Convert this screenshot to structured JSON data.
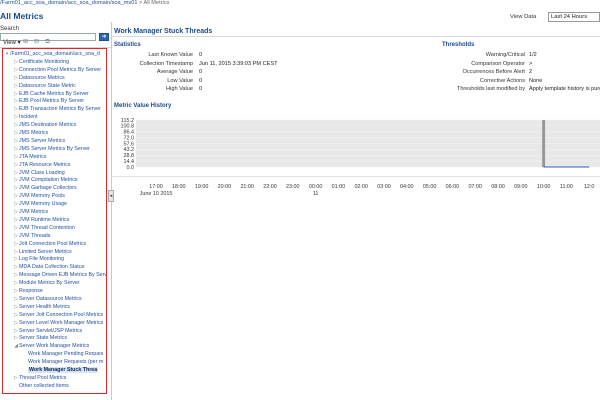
{
  "breadcrumb": {
    "path": "/Farm01_acc_soa_domain/acc_soa_domain/soa_ms01",
    "separator": ">",
    "current": "All Metrics"
  },
  "page_title": "All Metrics",
  "left_panel": {
    "search_label": "Search",
    "search_value": "",
    "view_label": "View ▾",
    "tree": [
      {
        "label": "/Farm01_acc_soa_domain/acc_soa_d",
        "level": 0,
        "toggle": "▾",
        "root": true
      },
      {
        "label": "Certificate Monitoring",
        "level": 1,
        "toggle": "▷"
      },
      {
        "label": "Connection Pool Metrics By Server",
        "level": 1,
        "toggle": "▷"
      },
      {
        "label": "Datasource Metrics",
        "level": 1,
        "toggle": "▷"
      },
      {
        "label": "Datasource State Metric",
        "level": 1,
        "toggle": "▷"
      },
      {
        "label": "EJB Cache Metrics By Server",
        "level": 1,
        "toggle": "▷"
      },
      {
        "label": "EJB Pool Metrics By Server",
        "level": 1,
        "toggle": "▷"
      },
      {
        "label": "EJB Transaction Metrics By Server",
        "level": 1,
        "toggle": "▷"
      },
      {
        "label": "Incident",
        "level": 1,
        "toggle": "▷"
      },
      {
        "label": "JMS Destination Metrics",
        "level": 1,
        "toggle": "▷"
      },
      {
        "label": "JMS Metrics",
        "level": 1,
        "toggle": "▷"
      },
      {
        "label": "JMS Server Metrics",
        "level": 1,
        "toggle": "▷"
      },
      {
        "label": "JMS Server Metrics By Server",
        "level": 1,
        "toggle": "▷"
      },
      {
        "label": "JTA Metrics",
        "level": 1,
        "toggle": "▷"
      },
      {
        "label": "JTA Resource Metrics",
        "level": 1,
        "toggle": "▷"
      },
      {
        "label": "JVM Class Loading",
        "level": 1,
        "toggle": "▷"
      },
      {
        "label": "JVM Compilation Metrics",
        "level": 1,
        "toggle": "▷"
      },
      {
        "label": "JVM Garbage Collectors",
        "level": 1,
        "toggle": "▷"
      },
      {
        "label": "JVM Memory Pools",
        "level": 1,
        "toggle": "▷"
      },
      {
        "label": "JVM Memory Usage",
        "level": 1,
        "toggle": "▷"
      },
      {
        "label": "JVM Metrics",
        "level": 1,
        "toggle": "▷"
      },
      {
        "label": "JVM Runtime Metrics",
        "level": 1,
        "toggle": "▷"
      },
      {
        "label": "JVM Thread Contention",
        "level": 1,
        "toggle": "▷"
      },
      {
        "label": "JVM Threads",
        "level": 1,
        "toggle": "▷"
      },
      {
        "label": "Jolt Connection Pool Metrics",
        "level": 1,
        "toggle": "▷"
      },
      {
        "label": "Limited Server Metrics",
        "level": 1,
        "toggle": "▷"
      },
      {
        "label": "Log File Monitoring",
        "level": 1,
        "toggle": "▷"
      },
      {
        "label": "MDA Data Collection Status",
        "level": 1,
        "toggle": "▷"
      },
      {
        "label": "Message Driven EJB Metrics By Serv",
        "level": 1,
        "toggle": "▷"
      },
      {
        "label": "Module Metrics By Server",
        "level": 1,
        "toggle": "▷"
      },
      {
        "label": "Response",
        "level": 1,
        "toggle": "▷"
      },
      {
        "label": "Server Datasource Metrics",
        "level": 1,
        "toggle": "▷"
      },
      {
        "label": "Server Health Metrics",
        "level": 1,
        "toggle": "▷"
      },
      {
        "label": "Server Jolt Connection Pool Metrics",
        "level": 1,
        "toggle": "▷"
      },
      {
        "label": "Server Level Work Manager Metrics",
        "level": 1,
        "toggle": "▷"
      },
      {
        "label": "Server Servlet/JSP Metrics",
        "level": 1,
        "toggle": "▷"
      },
      {
        "label": "Server State Metrics",
        "level": 1,
        "toggle": "▷"
      },
      {
        "label": "Server Work Manager Metrics",
        "level": 1,
        "toggle": "◢"
      },
      {
        "label": "Work Manager Pending Reques",
        "level": 2,
        "toggle": ""
      },
      {
        "label": "Work Manager Requests (per m",
        "level": 2,
        "toggle": ""
      },
      {
        "label": "Work Manager Stuck Threa",
        "level": 2,
        "toggle": "",
        "selected": true
      },
      {
        "label": "Thread Pool Metrics",
        "level": 1,
        "toggle": "▷"
      },
      {
        "label": "Other collected items",
        "level": 1,
        "toggle": ""
      }
    ]
  },
  "main": {
    "title": "Work Manager Stuck Threads",
    "view_data_label": "View Data",
    "view_data_value": "Last 24 Hours",
    "statistics": {
      "title": "Statistics",
      "rows": [
        {
          "label": "Last Known Value",
          "value": "0"
        },
        {
          "label": "Collection Timestamp",
          "value": "Jun 11, 2015 3:39:03 PM CEST"
        },
        {
          "label": "Average Value",
          "value": "0"
        },
        {
          "label": "Low Value",
          "value": "0"
        },
        {
          "label": "High Value",
          "value": "0"
        }
      ]
    },
    "thresholds": {
      "title": "Thresholds",
      "rows": [
        {
          "label": "Warning/Critical",
          "value": "1/2"
        },
        {
          "label": "Comparison Operator",
          "value": ">"
        },
        {
          "label": "Occurrences Before Alert",
          "value": "2"
        },
        {
          "label": "Corrective Actions",
          "value": "None"
        },
        {
          "label": "Thresholds last modified by",
          "value": "Apply template history is purg"
        }
      ]
    },
    "history_title": "Metric Value History"
  },
  "chart_data": {
    "type": "line",
    "title": "Metric Value History",
    "y_ticks": [
      "115.2",
      "100.8",
      "86.4",
      "72.0",
      "57.6",
      "43.2",
      "28.8",
      "14.4",
      "0.0"
    ],
    "ylim": [
      0,
      115.2
    ],
    "x_ticks": [
      "17:00",
      "18:00",
      "19:00",
      "20:00",
      "21:00",
      "22:00",
      "23:00",
      "00:00",
      "01:00",
      "02:00",
      "03:00",
      "04:00",
      "05:00",
      "06:00",
      "07:00",
      "08:00",
      "09:00",
      "10:00",
      "11:00",
      "12:0"
    ],
    "x_date_labels": [
      {
        "tick": "17:00",
        "text": "June 10 2015"
      },
      {
        "tick": "00:00",
        "text": "11"
      }
    ],
    "grid": true,
    "series": [
      {
        "x": [
          "10:00",
          "12:0"
        ],
        "y": [
          0,
          0
        ]
      }
    ],
    "colors": {
      "plot_bg": "#e8e8e8",
      "series": "#3060c0",
      "marker": "#999999"
    }
  }
}
